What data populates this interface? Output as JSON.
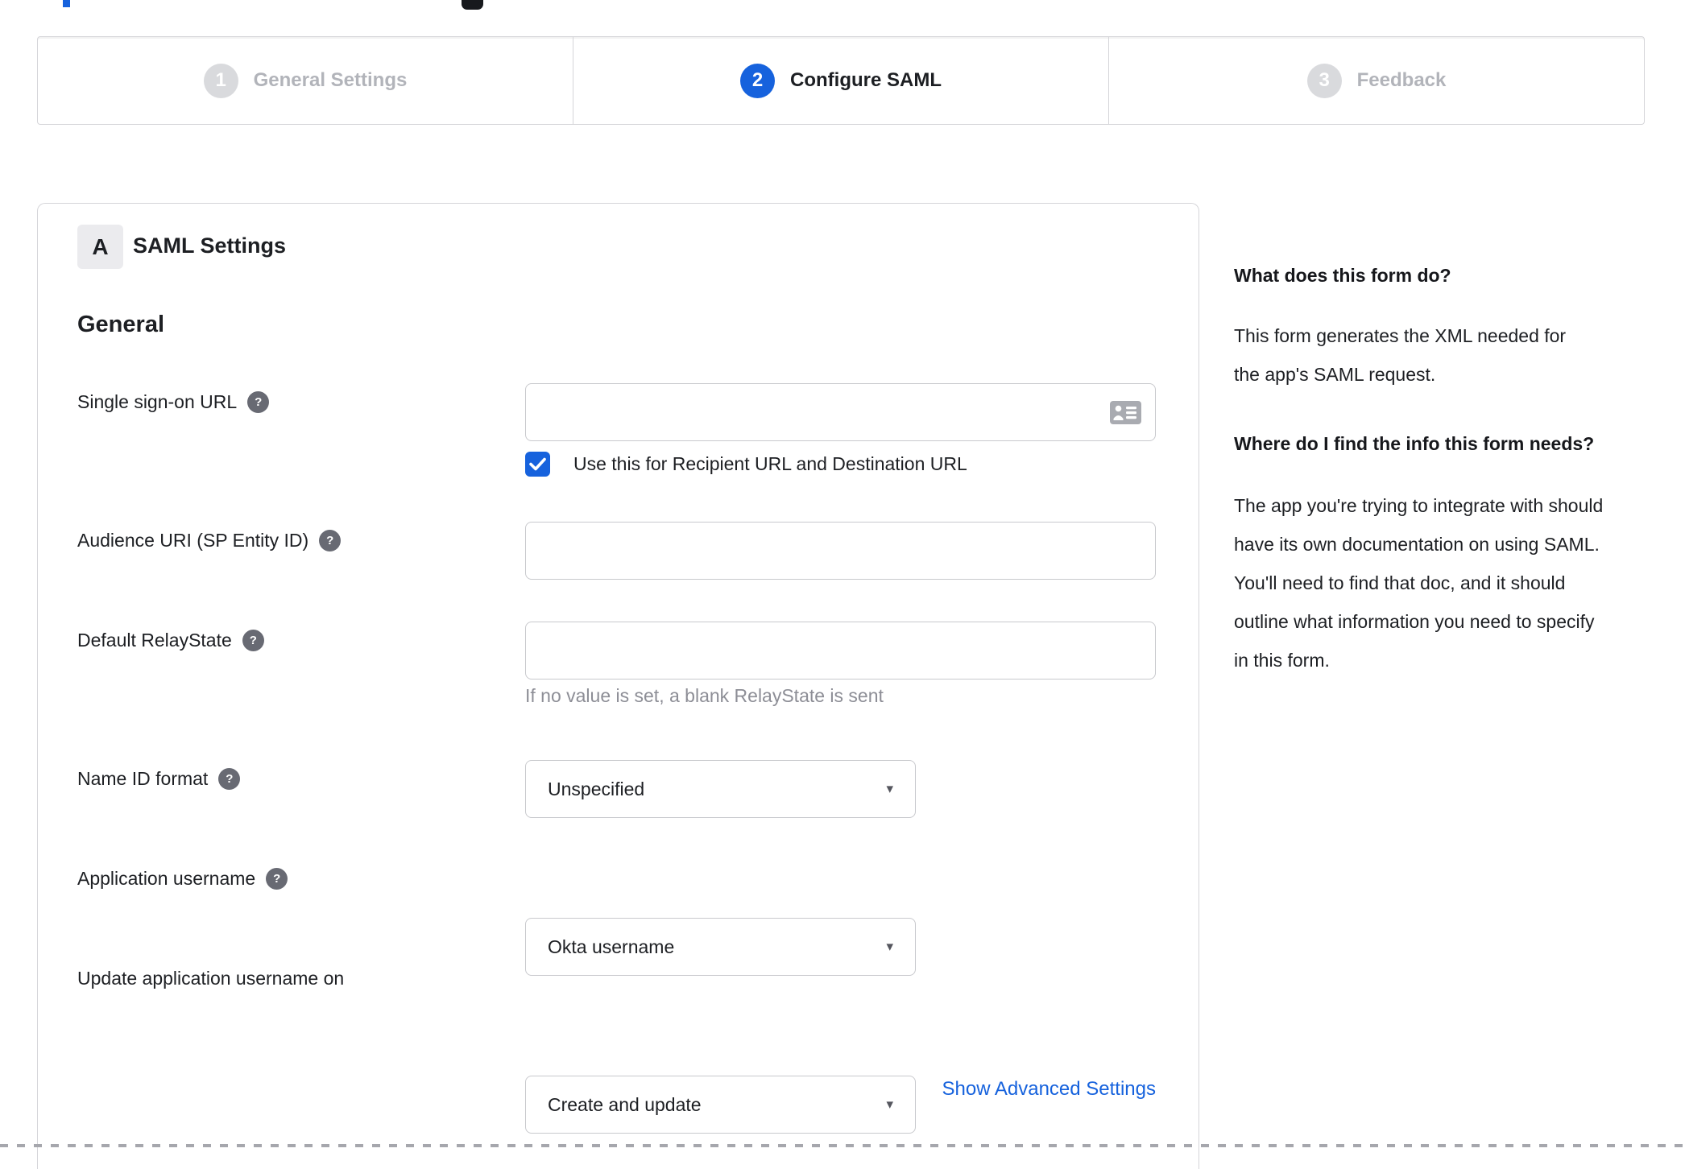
{
  "colors": {
    "accent_blue": "#1662dd",
    "inactive_gray": "#d9dadd",
    "panel_border": "#d5d5d9",
    "helper_text": "#8d8e96"
  },
  "stepper": {
    "steps": [
      {
        "number": "1",
        "label": "General Settings",
        "state": "inactive"
      },
      {
        "number": "2",
        "label": "Configure SAML",
        "state": "active"
      },
      {
        "number": "3",
        "label": "Feedback",
        "state": "inactive"
      }
    ]
  },
  "panel": {
    "section_badge": "A",
    "section_title": "SAML Settings",
    "group_title": "General",
    "fields": {
      "sso": {
        "label": "Single sign-on URL",
        "value": "",
        "checkbox_checked": true,
        "checkbox_label": "Use this for Recipient URL and Destination URL"
      },
      "audience": {
        "label": "Audience URI (SP Entity ID)",
        "value": ""
      },
      "relay": {
        "label": "Default RelayState",
        "value": "",
        "helper": "If no value is set, a blank RelayState is sent"
      },
      "nameid": {
        "label": "Name ID format",
        "value": "Unspecified"
      },
      "appuser": {
        "label": "Application username",
        "value": "Okta username"
      },
      "update": {
        "label": "Update application username on",
        "value": "Create and update"
      }
    },
    "advanced_link": "Show Advanced Settings"
  },
  "help_sidebar": {
    "heading1": "What does this form do?",
    "para1": "This form generates the XML needed for the app's SAML request.",
    "heading2": "Where do I find the info this form needs?",
    "para2": "The app you're trying to integrate with should have its own documentation on using SAML. You'll need to find that doc, and it should outline what information you need to specify in this form."
  },
  "icons": {
    "help_glyph": "?",
    "caret_glyph": "▾"
  }
}
